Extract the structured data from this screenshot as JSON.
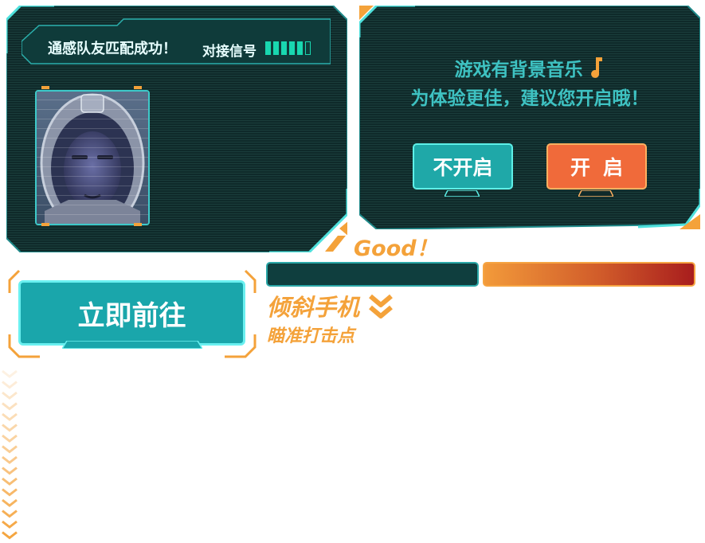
{
  "match_panel": {
    "title": "通感队友匹配成功！",
    "signal_label": "对接信号",
    "signal_level": 5,
    "signal_max": 6
  },
  "music_panel": {
    "line1": "游戏有背景音乐",
    "line2": "为体验更佳，建议您开启哦！",
    "note_icon": "music-note-icon",
    "btn_off": "不开启",
    "btn_on": "开启"
  },
  "feedback": {
    "good": "Good！"
  },
  "action": {
    "go_button": "立即前往",
    "tilt_title": "倾斜手机",
    "tilt_sub": "瞄准打击点"
  },
  "colors": {
    "teal_text": "#3ec2c2",
    "accent_orange": "#f4a23a",
    "button_teal": "#1fa8a8",
    "button_orange": "#f06a3a",
    "panel_bg": "#0f2a2a",
    "signal_green": "#19d7b0"
  }
}
